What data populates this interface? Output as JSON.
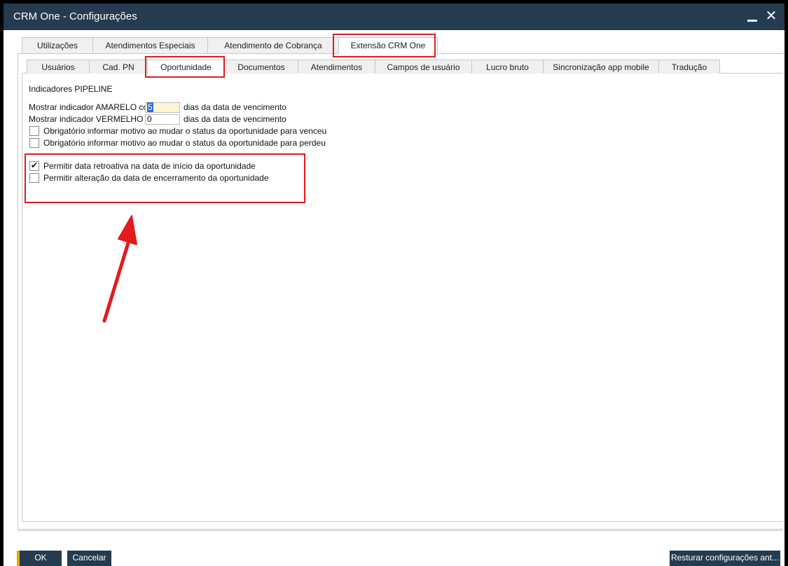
{
  "window": {
    "title": "CRM One - Configurações"
  },
  "tabs_top": [
    "Utilizações",
    "Atendimentos Especiais",
    "Atendimento de Cobrança",
    "Extensão CRM One"
  ],
  "tabs_sub": [
    "Usuários",
    "Cad. PN",
    "Oportunidade",
    "Documentos",
    "Atendimentos",
    "Campos de usuário",
    "Lucro bruto",
    "Sincronização app mobile",
    "Tradução"
  ],
  "section": {
    "title": "Indicadores PIPELINE",
    "amarelo_label": "Mostrar indicador AMARELO co",
    "amarelo_value": "5",
    "amarelo_suffix": "dias da data de vencimento",
    "vermelho_label": "Mostrar indicador VERMELHO c",
    "vermelho_value": "0",
    "vermelho_suffix": "dias da data de vencimento",
    "chk_venceu": "Obrigatório informar motivo ao mudar o status da oportunidade para venceu",
    "chk_perdeu": "Obrigatório informar motivo ao mudar o status da oportunidade para perdeu",
    "chk_retroativa": "Permitir data retroativa na data de início da oportunidade",
    "chk_encerramento": "Permitir alteração da data de encerramento da oportunidade"
  },
  "checkbox_states": {
    "venceu": false,
    "perdeu": false,
    "retroativa": true,
    "encerramento": false
  },
  "footer": {
    "ok": "OK",
    "cancel": "Cancelar",
    "restore": "Resturar configurações ant..."
  },
  "colors": {
    "titlebar": "#253b4f",
    "highlight": "#e31b1b",
    "accent": "#f0a500"
  }
}
